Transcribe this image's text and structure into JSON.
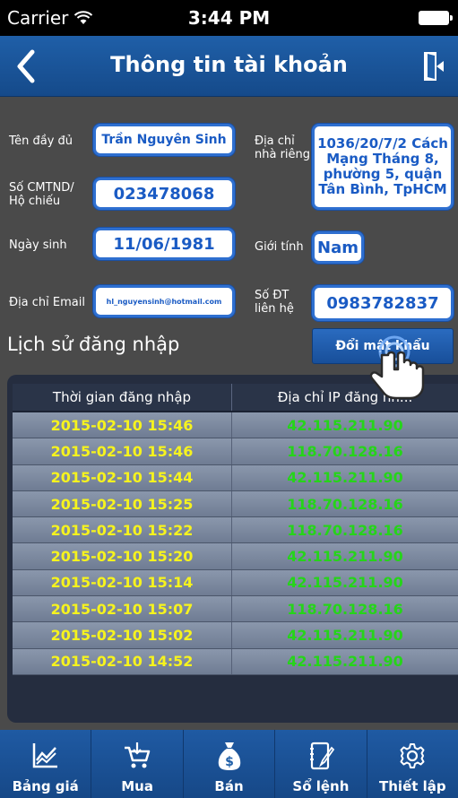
{
  "status_bar": {
    "carrier": "Carrier",
    "time": "3:44 PM"
  },
  "nav": {
    "title": "Thông tin tài khoản"
  },
  "form": {
    "full_name_label": "Tên đầy đủ",
    "full_name_value": "Trần Nguyên Sinh",
    "address_label_1": "Địa chỉ",
    "address_label_2": "nhà riêng",
    "address_value": "1036/20/7/2 Cách Mạng Tháng 8, phường 5, quận Tân Bình, TpHCM",
    "id_label_1": "Số CMTND/",
    "id_label_2": "Hộ chiếu",
    "id_value": "023478068",
    "dob_label": "Ngày sinh",
    "dob_value": "11/06/1981",
    "gender_label": "Giới tính",
    "gender_value": "Nam",
    "email_label": "Địa chỉ Email",
    "email_value": "hl_nguyensinh@hotmail.com",
    "phone_label_1": "Số ĐT",
    "phone_label_2": "liên hệ",
    "phone_value": "0983782837"
  },
  "login_history": {
    "title": "Lịch sử đăng nhập",
    "change_password_label": "Đổi mật khẩu",
    "columns": [
      "Thời gian đăng nhập",
      "Địa chỉ IP đăng nh..."
    ],
    "rows": [
      {
        "time": "2015-02-10 15:46",
        "ip": "42.115.211.90"
      },
      {
        "time": "2015-02-10 15:46",
        "ip": "118.70.128.16"
      },
      {
        "time": "2015-02-10 15:44",
        "ip": "42.115.211.90"
      },
      {
        "time": "2015-02-10 15:25",
        "ip": "118.70.128.16"
      },
      {
        "time": "2015-02-10 15:22",
        "ip": "118.70.128.16"
      },
      {
        "time": "2015-02-10 15:20",
        "ip": "42.115.211.90"
      },
      {
        "time": "2015-02-10 15:14",
        "ip": "42.115.211.90"
      },
      {
        "time": "2015-02-10 15:07",
        "ip": "118.70.128.16"
      },
      {
        "time": "2015-02-10 15:02",
        "ip": "42.115.211.90"
      },
      {
        "time": "2015-02-10 14:52",
        "ip": "42.115.211.90"
      }
    ]
  },
  "tabbar": {
    "items": [
      {
        "label": "Bảng giá",
        "icon": "chart-icon"
      },
      {
        "label": "Mua",
        "icon": "cart-icon"
      },
      {
        "label": "Bán",
        "icon": "money-bag-icon"
      },
      {
        "label": "Sổ lệnh",
        "icon": "notebook-icon"
      },
      {
        "label": "Thiết lập",
        "icon": "gear-icon"
      }
    ]
  },
  "colors": {
    "accent": "#1f5fa8",
    "time_text": "#f6f31e",
    "ip_text": "#26d41a",
    "field_border": "#2e6fd0"
  }
}
